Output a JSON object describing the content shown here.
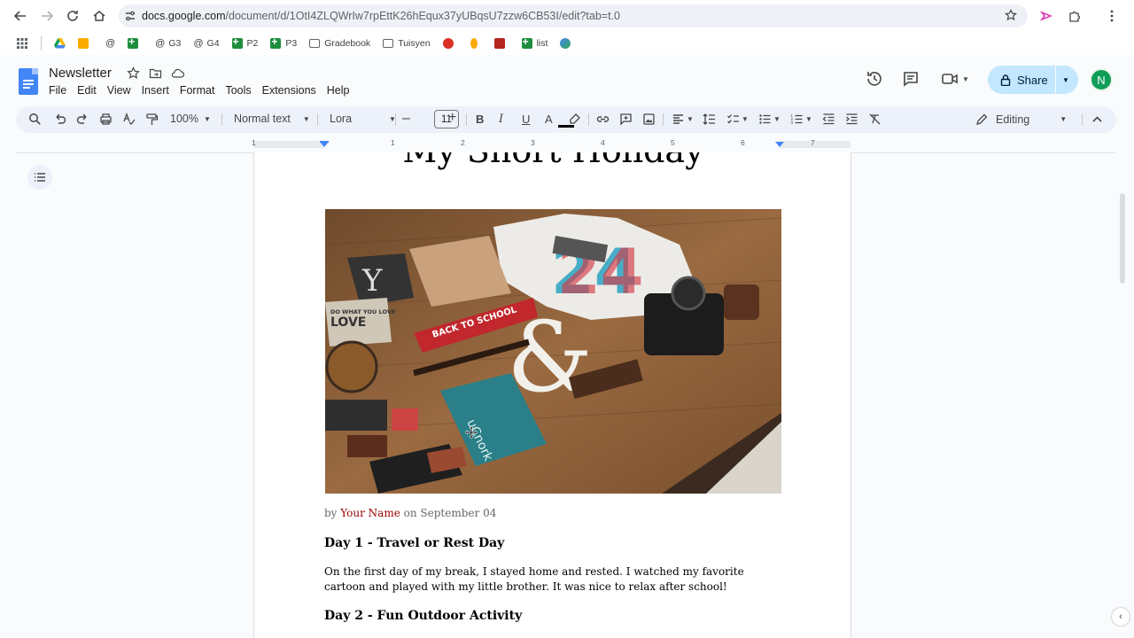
{
  "browser": {
    "url_host": "docs.google.com",
    "url_path": "/document/d/1OtI4ZLQWrIw7rpEttK26hEqux37yUBqsU7zzw6CB53I/edit?tab=t.0"
  },
  "bookmarks": [
    {
      "label": "",
      "icon": "apps-grid-icon"
    },
    {
      "label": "",
      "icon": "drive-icon"
    },
    {
      "label": "",
      "icon": "classroom-icon"
    },
    {
      "label": "",
      "icon": "web-icon"
    },
    {
      "label": "",
      "icon": "sheets-icon"
    },
    {
      "label": "G3",
      "icon": "web-icon"
    },
    {
      "label": "G4",
      "icon": "web-icon"
    },
    {
      "label": "P2",
      "icon": "sheets-icon"
    },
    {
      "label": "P3",
      "icon": "sheets-icon"
    },
    {
      "label": "Gradebook",
      "icon": "folder-icon"
    },
    {
      "label": "Tuisyen",
      "icon": "folder-icon"
    },
    {
      "label": "list",
      "icon": "sheets-icon"
    }
  ],
  "doc": {
    "title": "Newsletter",
    "menu": [
      "File",
      "Edit",
      "View",
      "Insert",
      "Format",
      "Tools",
      "Extensions",
      "Help"
    ],
    "share_label": "Share",
    "avatar_letter": "N"
  },
  "toolbar": {
    "zoom": "100%",
    "style": "Normal text",
    "font": "Lora",
    "font_size": "11",
    "mode": "Editing"
  },
  "ruler": {
    "numbers": [
      "1",
      "1",
      "2",
      "3",
      "4",
      "5",
      "6",
      "7"
    ]
  },
  "content": {
    "heading": "My Short Holiday",
    "byline_prefix": "by",
    "byline_name": "Your Name",
    "byline_suffix": "on September 04",
    "day1_title": "Day 1 - Travel or Rest Day",
    "day1_text": "On the first day of my break, I stayed home and rested. I watched my favorite cartoon and played with my little brother. It was nice to relax after school!",
    "day2_title": "Day 2 - Fun Outdoor Activity"
  },
  "photo": {
    "pennant_text": "BACK TO SCHOOL",
    "tshirt_text": "24",
    "book_text": "DO WHAT YOU LOVE",
    "colors": {
      "wood": "#8a5a35",
      "pennant": "#c1272d",
      "teal": "#2a7f88"
    }
  },
  "colors": {
    "share_bg": "#c2e7ff",
    "avatar": "#0f9d58",
    "byline_name": "#990000"
  }
}
